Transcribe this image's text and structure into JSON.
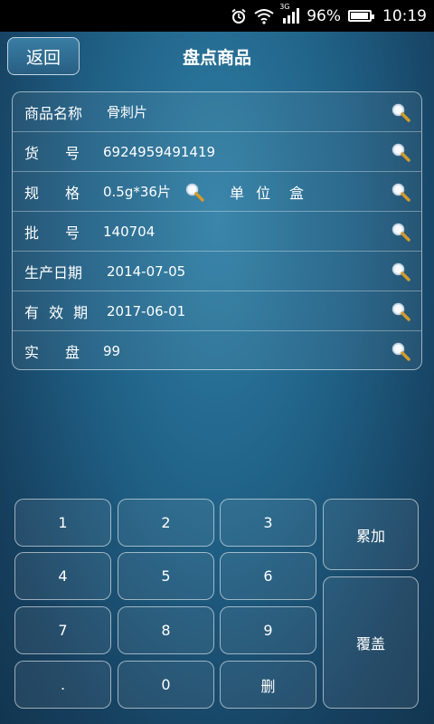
{
  "status": {
    "network": "3G",
    "battery": "96%",
    "battery_level": 0.96,
    "time": "10:19"
  },
  "header": {
    "back_label": "返回",
    "title": "盘点商品"
  },
  "form": {
    "name_label": "商品名称",
    "name_value": "骨刺片",
    "code_label_1": "货",
    "code_label_2": "号",
    "code_value": "6924959491419",
    "spec_label_1": "规",
    "spec_label_2": "格",
    "spec_value": "0.5g*36片",
    "unit_label": "单 位",
    "unit_value": "盒",
    "batch_label_1": "批",
    "batch_label_2": "号",
    "batch_value": "140704",
    "mfg_label": "生产日期",
    "mfg_value": "2014-07-05",
    "exp_label": "有 效 期",
    "exp_value": "2017-06-01",
    "count_label_1": "实",
    "count_label_2": "盘",
    "count_value": "99"
  },
  "keypad": {
    "k1": "1",
    "k2": "2",
    "k3": "3",
    "k4": "4",
    "k5": "5",
    "k6": "6",
    "k7": "7",
    "k8": "8",
    "k9": "9",
    "kdot": ".",
    "k0": "0",
    "kdel": "删",
    "accumulate": "累加",
    "overwrite": "覆盖"
  },
  "icons": {
    "search": "magnifier-icon"
  }
}
